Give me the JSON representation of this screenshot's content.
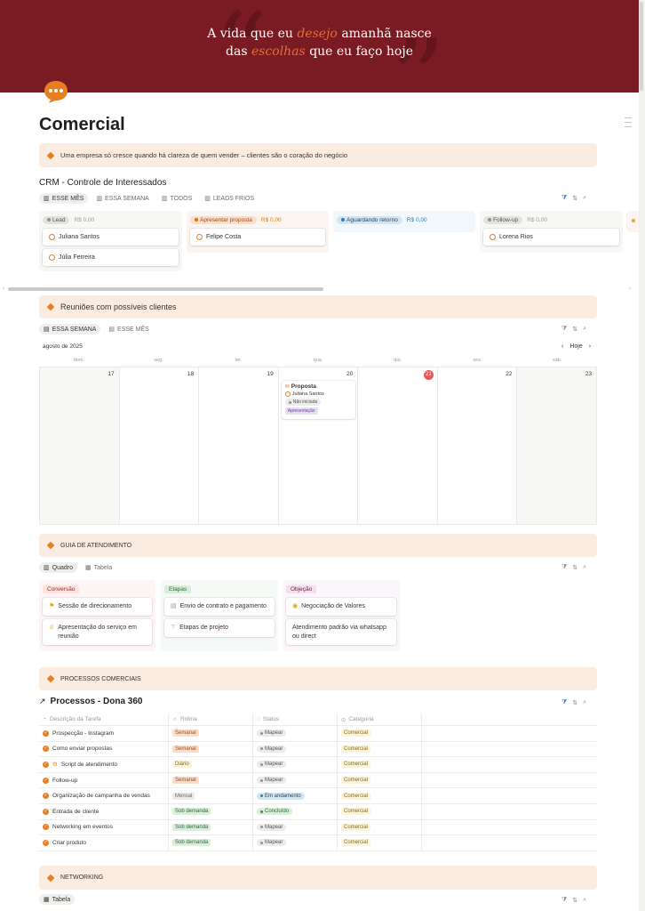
{
  "banner": {
    "line1_a": "A vida que eu",
    "line1_hl": "desejo",
    "line1_b": "amanhã nasce",
    "line2_a": "das",
    "line2_hl": "escolhas",
    "line2_b": "que eu faço hoje"
  },
  "page": {
    "title": "Comercial",
    "icon": "speech-bubble-icon"
  },
  "callout_main": "Uma empresa só cresce quando há clareza de quem vender – clientes são o coração do negócio",
  "crm": {
    "title": "CRM - Controle de Interessados",
    "tabs": [
      "ESSE MÊS",
      "ESSA SEMANA",
      "TODOS",
      "LEADS FRIOS"
    ],
    "columns": [
      {
        "label": "Lead",
        "value": "R$ 0,00",
        "cards": [
          "Juliana Santos",
          "Júlia Ferreira"
        ]
      },
      {
        "label": "Apresentar proposta",
        "value": "R$ 0,00",
        "cards": [
          "Felipe Costa"
        ]
      },
      {
        "label": "Aguardando retorno",
        "value": "R$ 0,00",
        "cards": []
      },
      {
        "label": "Follow-up",
        "value": "R$ 0,00",
        "cards": [
          "Lorena Rios"
        ]
      }
    ]
  },
  "meetings": {
    "title": "Reuniões com possíveis clientes",
    "tabs": [
      "ESSA SEMANA",
      "ESSE MÊS"
    ],
    "month": "agosto de 2025",
    "today_label": "Hoje",
    "weekdays": [
      "dom.",
      "seg.",
      "ter.",
      "qua.",
      "qui.",
      "sex.",
      "sáb."
    ],
    "days": [
      "17",
      "18",
      "19",
      "20",
      "21",
      "22",
      "23"
    ],
    "event": {
      "title": "Proposta",
      "person": "Juliana Santos",
      "status": "Não iniciada",
      "tag": "Apresentação"
    }
  },
  "guide": {
    "title": "GUIA DE ATENDIMENTO",
    "tabs": [
      "Quadro",
      "Tabela"
    ],
    "columns": [
      {
        "label": "Conversão",
        "cards": [
          "Sessão de direcionamento",
          "Apresentação do serviço em reunião"
        ]
      },
      {
        "label": "Etapas",
        "cards": [
          "Envio de contrato e pagamento",
          "Etapas de projeto"
        ]
      },
      {
        "label": "Objeção",
        "cards": [
          "Negociação de Valores",
          "Atendimento padrão via whatsapp ou direct"
        ]
      }
    ]
  },
  "processes": {
    "callout": "PROCESSOS COMERCIAIS",
    "title": "Processos - Dona 360",
    "headers": [
      "Descrição da Tarefa",
      "Rotina",
      "Status",
      "Categoria"
    ],
    "rows": [
      {
        "task": "Prospecção - Instagram",
        "rotina": "Semanal",
        "status": "Mapear",
        "cat": "Comercial"
      },
      {
        "task": "Como enviar propostas",
        "rotina": "Semanal",
        "status": "Mapear",
        "cat": "Comercial"
      },
      {
        "task": "Script de atendimento",
        "rotina": "Diário",
        "status": "Mapear",
        "cat": "Comercial"
      },
      {
        "task": "Follow-up",
        "rotina": "Semanal",
        "status": "Mapear",
        "cat": "Comercial"
      },
      {
        "task": "Organização de campanha de vendas",
        "rotina": "Mensal",
        "status": "Em andamento",
        "cat": "Comercial"
      },
      {
        "task": "Entrada de cliente",
        "rotina": "Sob demanda",
        "status": "Concluído",
        "cat": "Comercial"
      },
      {
        "task": "Networking em eventos",
        "rotina": "Sob demanda",
        "status": "Mapear",
        "cat": "Comercial"
      },
      {
        "task": "Criar produto",
        "rotina": "Sob demanda",
        "status": "Mapear",
        "cat": "Comercial"
      }
    ]
  },
  "networking": {
    "callout": "NETWORKING",
    "tab": "Tabela"
  }
}
